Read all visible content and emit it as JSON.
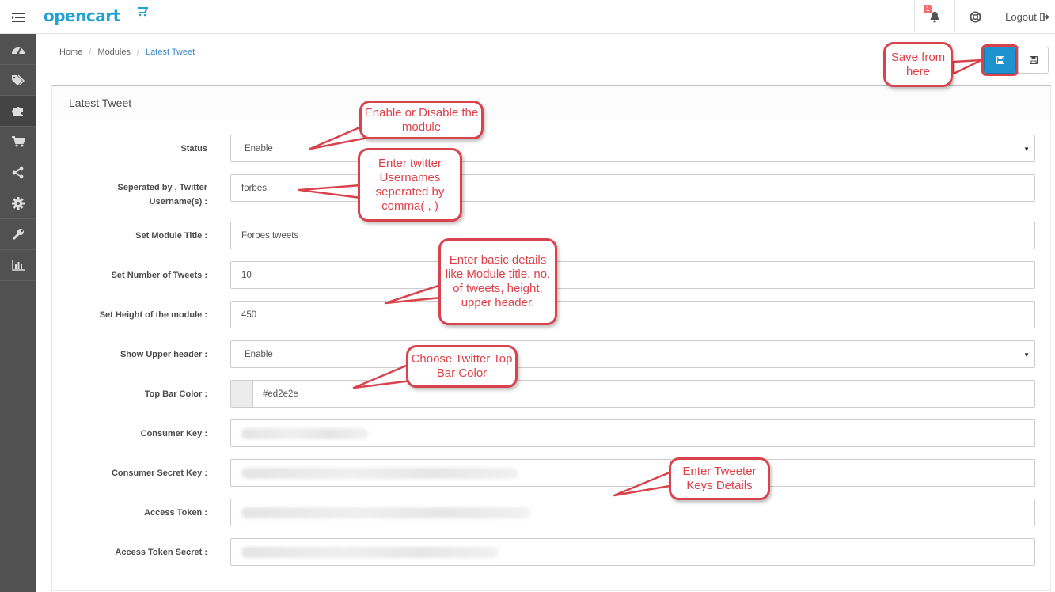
{
  "header": {
    "logo": "opencart",
    "notification_count": "1",
    "logout_label": "Logout"
  },
  "breadcrumb": [
    "Home",
    "Modules",
    "Latest Tweet"
  ],
  "panel": {
    "title": "Latest Tweet"
  },
  "form": {
    "status": {
      "label": "Status",
      "value": "Enable"
    },
    "usernames": {
      "label_1": "Seperated by , Twitter",
      "label_2": "Username(s) :",
      "value": "forbes"
    },
    "module_title": {
      "label": "Set Module Title :",
      "value": "Forbes tweets"
    },
    "num_tweets": {
      "label": "Set Number of Tweets :",
      "value": "10"
    },
    "height": {
      "label": "Set Height of the module :",
      "value": "450"
    },
    "upper_header": {
      "label": "Show Upper header :",
      "value": "Enable"
    },
    "top_bar_color": {
      "label": "Top Bar Color :",
      "value": "#ed2e2e"
    },
    "consumer_key": {
      "label": "Consumer Key :"
    },
    "consumer_secret": {
      "label": "Consumer Secret Key :"
    },
    "access_token": {
      "label": "Access Token :"
    },
    "access_token_secret": {
      "label": "Access Token Secret :"
    }
  },
  "callouts": {
    "save": "Save from here",
    "enable": "Enable or Disable the module",
    "usernames": "Enter twitter Usernames seperated by comma( , )",
    "basic": "Enter basic details like Module title, no. of tweets, height, upper header.",
    "color": "Choose Twitter Top Bar Color",
    "keys": "Enter Tweeter Keys Details"
  },
  "colors": {
    "brand": "#23a1d1",
    "primary": "#1e91cf",
    "annotation": "#d9434d",
    "sidebar": "#515151"
  }
}
